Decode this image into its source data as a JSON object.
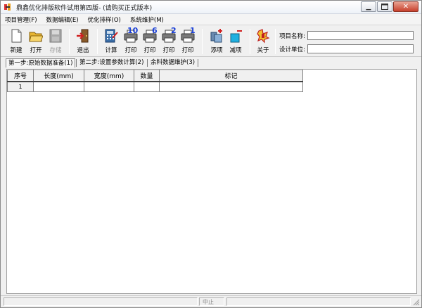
{
  "window": {
    "title": "鼎鑫优化排版软件试用第四版- (请购买正式版本)"
  },
  "menu": {
    "items": [
      "项目管理(F)",
      "数据编辑(E)",
      "优化排样(O)",
      "系统维护(M)"
    ]
  },
  "toolbar": {
    "new_label": "新建",
    "open_label": "打开",
    "save_label": "存储",
    "exit_label": "退出",
    "calc_label": "计算",
    "print1_label": "打印",
    "print1_num": "10",
    "print2_label": "打印",
    "print2_num": "6",
    "print3_label": "打印",
    "print3_num": "2",
    "print4_label": "打印",
    "print4_num": "1",
    "add_label": "添项",
    "remove_label": "减项",
    "about_label": "关于",
    "project_name_label": "项目名称:",
    "project_name_value": "",
    "design_unit_label": "设计单位:",
    "design_unit_value": ""
  },
  "tabs": [
    "第一步:原始数据准备(1)",
    "第二步:设置参数计算(2)",
    "余料数据维护(3)"
  ],
  "grid": {
    "columns": [
      "序号",
      "长度(mm)",
      "宽度(mm)",
      "数量",
      "标记"
    ],
    "rows": [
      [
        "1",
        "",
        "",
        "",
        ""
      ]
    ]
  },
  "statusbar": {
    "text": "中止"
  },
  "colors": {
    "accent_number": "#1a3fd6",
    "close_button": "#c7402c"
  }
}
